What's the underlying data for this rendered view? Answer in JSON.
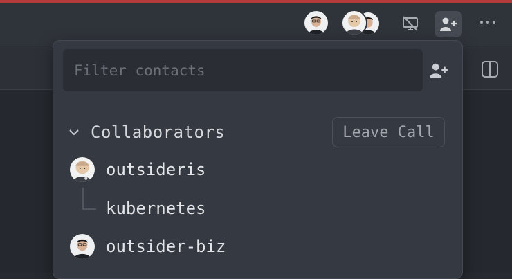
{
  "filter": {
    "placeholder": "Filter contacts",
    "value": ""
  },
  "section": {
    "title": "Collaborators",
    "leave_label": "Leave Call"
  },
  "participants": [
    {
      "name": "outsideris",
      "avatar": "bald-avatar"
    },
    {
      "name": "kubernetes",
      "avatar": ""
    },
    {
      "name": "outsider-biz",
      "avatar": "person-avatar"
    }
  ],
  "colors": {
    "window_accent": "#b23b3b",
    "popover_bg": "#353942"
  }
}
